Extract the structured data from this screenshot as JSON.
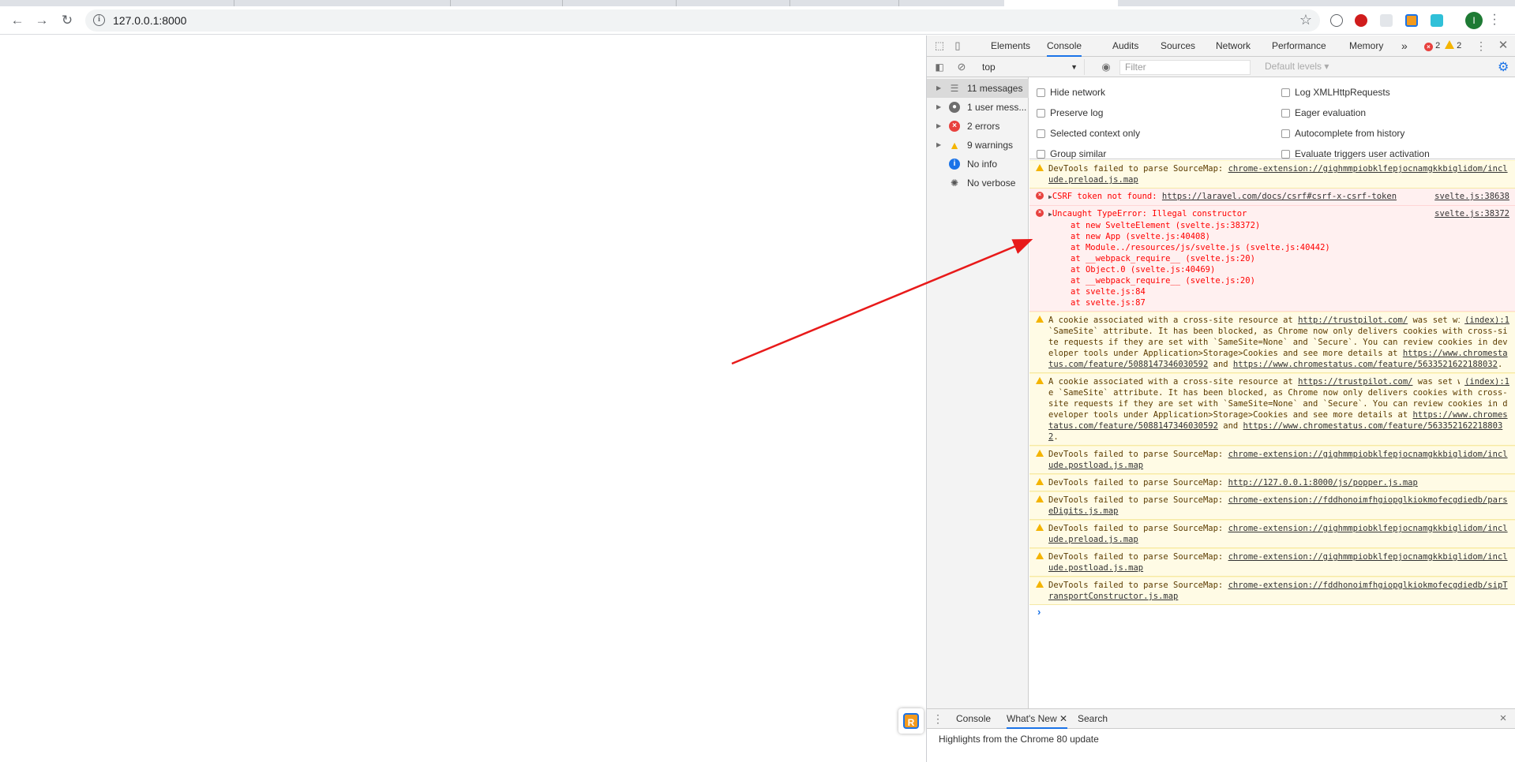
{
  "browser": {
    "url": "127.0.0.1:8000",
    "profile_initial": "I"
  },
  "devtools": {
    "tabs": [
      "Elements",
      "Console",
      "Audits",
      "Sources",
      "Network",
      "Performance",
      "Memory"
    ],
    "more_tabs": "»",
    "error_count": "2",
    "warning_count": "2",
    "context": "top",
    "filter_placeholder": "Filter",
    "levels": "Default levels ▾",
    "sidebar": [
      {
        "label": "11 messages",
        "icon": "list-icon"
      },
      {
        "label": "1 user mess...",
        "icon": "user-icon"
      },
      {
        "label": "2 errors",
        "icon": "error-icon"
      },
      {
        "label": "9 warnings",
        "icon": "warning-icon"
      },
      {
        "label": "No info",
        "icon": "info-icon"
      },
      {
        "label": "No verbose",
        "icon": "bug-icon"
      }
    ],
    "settings_left": [
      "Hide network",
      "Preserve log",
      "Selected context only",
      "Group similar"
    ],
    "settings_right": [
      "Log XMLHttpRequests",
      "Eager evaluation",
      "Autocomplete from history",
      "Evaluate triggers user activation"
    ],
    "messages": {
      "m1_text": "DevTools failed to parse SourceMap: ",
      "m1_link": "chrome-extension://gighmmpiobklfepjocnamgkkbiglidom/include.preload.js.map",
      "m2_text": "CSRF token not found: ",
      "m2_link": "https://laravel.com/docs/csrf#csrf-x-csrf-token",
      "m2_src": "svelte.js:38638",
      "m3_text": "Uncaught TypeError: Illegal constructor",
      "m3_src": "svelte.js:38372",
      "m3_stack": [
        "at new SvelteElement (svelte.js:38372)",
        "at new App (svelte.js:40408)",
        "at Module../resources/js/svelte.js (svelte.js:40442)",
        "at __webpack_require__ (svelte.js:20)",
        "at Object.0 (svelte.js:40469)",
        "at __webpack_require__ (svelte.js:20)",
        "at svelte.js:84",
        "at svelte.js:87"
      ],
      "m4_a": "A cookie associated with a cross-site resource at ",
      "m4_link1": "http://trustpilot.com/",
      "m4_b": " was set without the `SameSite` attribute. It has been blocked, as Chrome now only delivers cookies with cross-site requests if they are set with `SameSite=None` and `Secure`. You can review cookies in developer tools under Application>Storage>Cookies and see more details at ",
      "m4_link2": "https://www.chromestatus.com/feature/5088147346030592",
      "m4_c": " and ",
      "m4_link3": "https://www.chromestatus.com/feature/5633521622188032",
      "m4_d": ".",
      "m4_src": "(index):1",
      "m5_a": "A cookie associated with a cross-site resource at ",
      "m5_link1": "https://trustpilot.com/",
      "m5_b": " was set without the `SameSite` attribute. It has been blocked, as Chrome now only delivers cookies with cross-site requests if they are set with `SameSite=None` and `Secure`. You can review cookies in developer tools under Application>Storage>Cookies and see more details at ",
      "m5_link2": "https://www.chromestatus.com/feature/5088147346030592",
      "m5_c": " and ",
      "m5_link3": "https://www.chromestatus.com/feature/5633521622188032",
      "m5_d": ".",
      "m5_src": "(index):1",
      "m6_text": "DevTools failed to parse SourceMap: ",
      "m6_link": "chrome-extension://gighmmpiobklfepjocnamgkkbiglidom/include.postload.js.map",
      "m7_text": "DevTools failed to parse SourceMap: ",
      "m7_link": "http://127.0.0.1:8000/js/popper.js.map",
      "m8_text": "DevTools failed to parse SourceMap: ",
      "m8_link": "chrome-extension://fddhonoimfhgiopglkiokmofecgdiedb/parseDigits.js.map",
      "m9_text": "DevTools failed to parse SourceMap: ",
      "m9_link": "chrome-extension://gighmmpiobklfepjocnamgkkbiglidom/include.preload.js.map",
      "m10_text": "DevTools failed to parse SourceMap: ",
      "m10_link": "chrome-extension://gighmmpiobklfepjocnamgkkbiglidom/include.postload.js.map",
      "m11_text": "DevTools failed to parse SourceMap: ",
      "m11_link": "chrome-extension://fddhonoimfhgiopglkiokmofecgdiedb/sipTransportConstructor.js.map"
    },
    "prompt": "›",
    "drawer_tabs": [
      "Console",
      "What's New",
      "Search"
    ],
    "drawer_close": "×",
    "drawer_text": "Highlights from the Chrome 80 update"
  },
  "colors": {
    "accent": "#1a73e8",
    "error": "#e8413e",
    "warning": "#f4b400",
    "annotation_arrow": "#e81a1a"
  }
}
